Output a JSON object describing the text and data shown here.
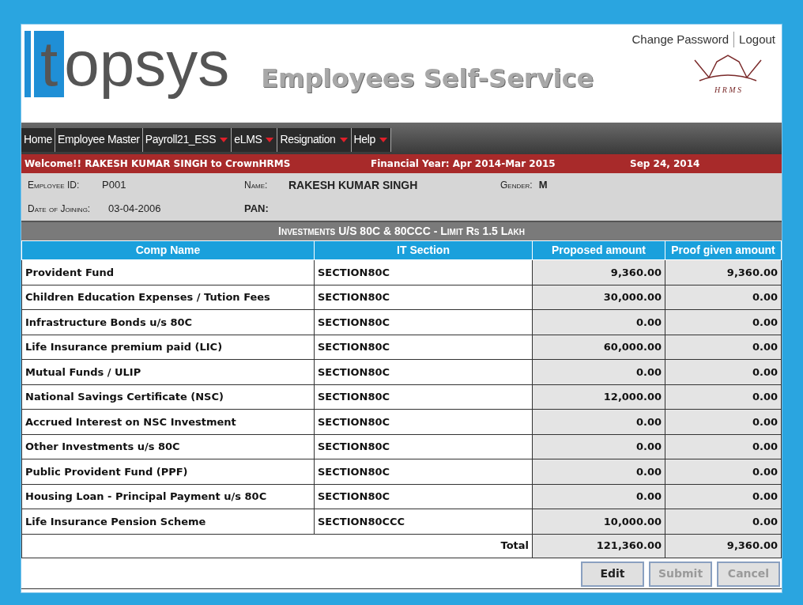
{
  "header": {
    "logo_letter": "t",
    "logo_text": "opsys",
    "banner": "Employees Self-Service",
    "links": [
      "Change Password",
      "Logout"
    ],
    "crown_text": "H R M S"
  },
  "nav": [
    {
      "label": "Home",
      "dropdown": false
    },
    {
      "label": "Employee Master",
      "dropdown": false
    },
    {
      "label": "Payroll21_ESS",
      "dropdown": true
    },
    {
      "label": "eLMS",
      "dropdown": true
    },
    {
      "label": "Resignation",
      "dropdown": true
    },
    {
      "label": "Help",
      "dropdown": true
    }
  ],
  "status_bar": {
    "welcome": "Welcome!! RAKESH KUMAR SINGH to CrownHRMS",
    "financial_year": "Financial Year: Apr 2014-Mar 2015",
    "date": "Sep 24, 2014"
  },
  "employee": {
    "id_label": "Employee ID:",
    "id": "P001",
    "name_label": "Name:",
    "name": "RAKESH KUMAR SINGH",
    "gender_label": "Gender:",
    "gender": "M",
    "doj_label": "Date of Joining:",
    "doj": "03-04-2006",
    "pan_label": "PAN:"
  },
  "table": {
    "title": "Investments U/S 80C & 80CCC - Limit Rs 1.5  Lakh",
    "columns": [
      "Comp Name",
      "IT Section",
      "Proposed amount",
      "Proof given amount"
    ],
    "rows": [
      [
        "Provident Fund",
        "SECTION80C",
        "9,360.00",
        "9,360.00"
      ],
      [
        "Children Education Expenses / Tution Fees",
        "SECTION80C",
        "30,000.00",
        "0.00"
      ],
      [
        "Infrastructure Bonds u/s 80C",
        "SECTION80C",
        "0.00",
        "0.00"
      ],
      [
        "Life Insurance premium paid (LIC)",
        "SECTION80C",
        "60,000.00",
        "0.00"
      ],
      [
        "Mutual Funds / ULIP",
        "SECTION80C",
        "0.00",
        "0.00"
      ],
      [
        "National Savings Certificate (NSC)",
        "SECTION80C",
        "12,000.00",
        "0.00"
      ],
      [
        "Accrued Interest on NSC Investment",
        "SECTION80C",
        "0.00",
        "0.00"
      ],
      [
        "Other Investments u/s 80C",
        "SECTION80C",
        "0.00",
        "0.00"
      ],
      [
        "Public Provident Fund (PPF)",
        "SECTION80C",
        "0.00",
        "0.00"
      ],
      [
        "Housing Loan - Principal Payment u/s 80C",
        "SECTION80C",
        "0.00",
        "0.00"
      ],
      [
        "Life Insurance Pension Scheme",
        "SECTION80CCC",
        "10,000.00",
        "0.00"
      ]
    ],
    "total_label": "Total",
    "total_proposed": "121,360.00",
    "total_proof": "9,360.00"
  },
  "buttons": [
    {
      "label": "Edit",
      "disabled": false
    },
    {
      "label": "Submit",
      "disabled": true
    },
    {
      "label": "Cancel",
      "disabled": true
    }
  ]
}
